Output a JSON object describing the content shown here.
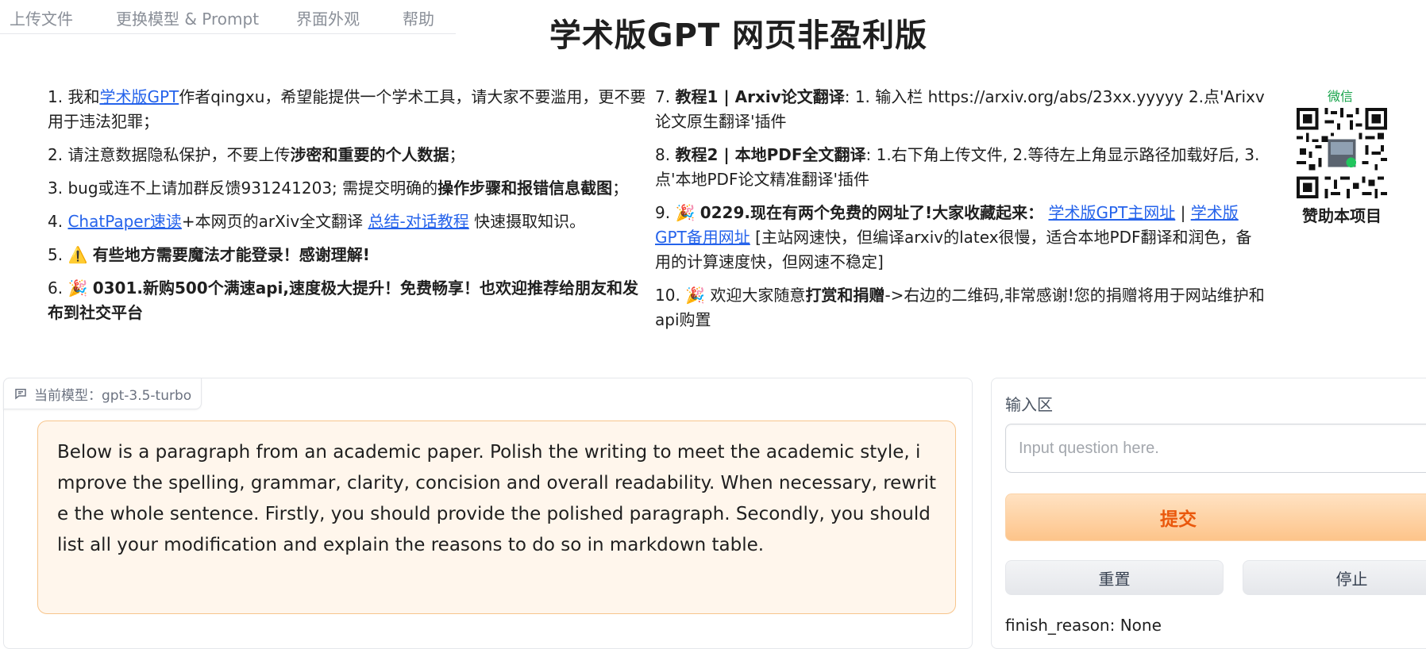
{
  "tabs": [
    "上传文件",
    "更换模型 & Prompt",
    "界面外观",
    "帮助"
  ],
  "page_title": "学术版GPT 网页非盈利版",
  "notices_left": [
    {
      "num": "1.",
      "t1": "我和",
      "link": "学术版GPT",
      "t2": "作者qingxu，希望能提供一个学术工具，请大家不要滥用，更不要用于违法犯罪；"
    },
    {
      "num": "2.",
      "t1": "请注意数据隐私保护，不要上传",
      "bold": "涉密和重要的个人数据",
      "t2": "；"
    },
    {
      "num": "3.",
      "t1": "bug或连不上请加群反馈931241203; 需提交明确的",
      "bold": "操作步骤和报错信息截图",
      "t2": "；"
    },
    {
      "num": "4.",
      "link1": "ChatPaper速读",
      "t1": "+本网页的arXiv全文翻译 ",
      "link2": "总结-对话教程",
      "t2": " 快速摄取知识。"
    },
    {
      "num": "5.",
      "emoji": "⚠️",
      "bold": "有些地方需要魔法才能登录！感谢理解!"
    },
    {
      "num": "6.",
      "emoji": "🎉",
      "bold": "0301.新购500个满速api,速度极大提升！免费畅享！也欢迎推荐给朋友和发布到社交平台"
    }
  ],
  "notices_right": [
    {
      "num": "7.",
      "bold": "教程1 | Arxiv论文翻译",
      "t1": ": 1. 输入栏 https://arxiv.org/abs/23xx.yyyyy 2.点'Arixv论文原生翻译'插件"
    },
    {
      "num": "8.",
      "bold": "教程2 | 本地PDF全文翻译",
      "t1": ": 1.右下角上传文件, 2.等待左上角显示路径加载好后, 3.点'本地PDF论文精准翻译'插件"
    },
    {
      "num": "9.",
      "emoji": "🎉",
      "bold": "0229.现在有两个免费的网址了!大家收藏起来：",
      "link1": "学术版GPT主网址",
      "sep": " | ",
      "link2": "学术版GPT备用网址",
      "t1": " [主站网速快，但编译arxiv的latex很慢，适合本地PDF翻译和润色，备用的计算速度快，但网速不稳定]"
    },
    {
      "num": "10.",
      "emoji": "🎉",
      "t1": "欢迎大家随意",
      "bold": "打赏和捐赠",
      "t2": "->右边的二维码,非常感谢!您的捐赠将用于网站维护和api购置"
    }
  ],
  "sponsor": {
    "wechat_label": "微信",
    "caption": "赞助本项目"
  },
  "chat": {
    "model_label": "当前模型：gpt-3.5-turbo",
    "message": "Below is a paragraph from an academic paper. Polish the writing to meet the academic style, improve the spelling, grammar, clarity, concision and overall readability. When necessary, rewrite the whole sentence. Firstly, you should provide the polished paragraph. Secondly, you should list all your modification and explain the reasons to do so in markdown table."
  },
  "input_area": {
    "label": "输入区",
    "placeholder": "Input question here.",
    "value": "",
    "submit": "提交",
    "reset": "重置",
    "stop": "停止",
    "status": "finish_reason: None"
  },
  "colors": {
    "accent": "#ea580c",
    "link": "#2563eb",
    "bubble_bg": "#fff6ec",
    "bubble_border": "#f7c58c",
    "wechat": "#16a34a"
  }
}
